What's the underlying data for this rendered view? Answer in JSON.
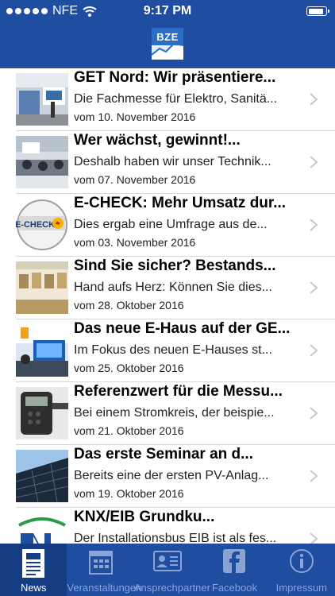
{
  "status_bar": {
    "carrier": "NFE",
    "time": "9:17 PM",
    "battery_level": 0.92
  },
  "header": {
    "logo_text": "BZE"
  },
  "news": [
    {
      "title": "GET Nord: Wir präsentiere...",
      "subtitle": "Die Fachmesse für Elektro, Sanitä...",
      "date": "vom 10. November 2016"
    },
    {
      "title": "Wer wächst, gewinnt!...",
      "subtitle": "Deshalb haben wir unser Technik...",
      "date": "vom 07. November 2016"
    },
    {
      "title": "E-CHECK: Mehr Umsatz dur...",
      "subtitle": "Dies ergab eine Umfrage aus de...",
      "date": "vom 03. November 2016",
      "thumb_text": "E-CHECK"
    },
    {
      "title": "Sind Sie sicher? Bestands...",
      "subtitle": "Hand aufs Herz: Können Sie dies...",
      "date": "vom 28. Oktober 2016"
    },
    {
      "title": "Das neue E-Haus auf der GE...",
      "subtitle": "Im Fokus des neuen E-Hauses st...",
      "date": "vom 25. Oktober 2016"
    },
    {
      "title": "Referenzwert für die Messu...",
      "subtitle": "Bei einem Stromkreis, der beispie...",
      "date": "vom 21. Oktober 2016"
    },
    {
      "title": "Das erste Seminar an d...",
      "subtitle": "Bereits eine der ersten PV-Anlag...",
      "date": "vom 19. Oktober 2016"
    },
    {
      "title": "KNX/EIB Grundku...",
      "subtitle": "Der Installationsbus EIB ist als fes...",
      "date": ""
    }
  ],
  "tabs": [
    {
      "label": "News",
      "icon": "newspaper-icon",
      "active": true
    },
    {
      "label": "Veranstaltungen",
      "icon": "calendar-icon",
      "active": false
    },
    {
      "label": "Ansprechpartner",
      "icon": "contact-card-icon",
      "active": false
    },
    {
      "label": "Facebook",
      "icon": "facebook-icon",
      "active": false
    },
    {
      "label": "Impressum",
      "icon": "info-icon",
      "active": false
    }
  ],
  "colors": {
    "bar": "#1f4da0",
    "active_tab": "#163c82",
    "inactive_tab_label": "#8aa3d4"
  }
}
